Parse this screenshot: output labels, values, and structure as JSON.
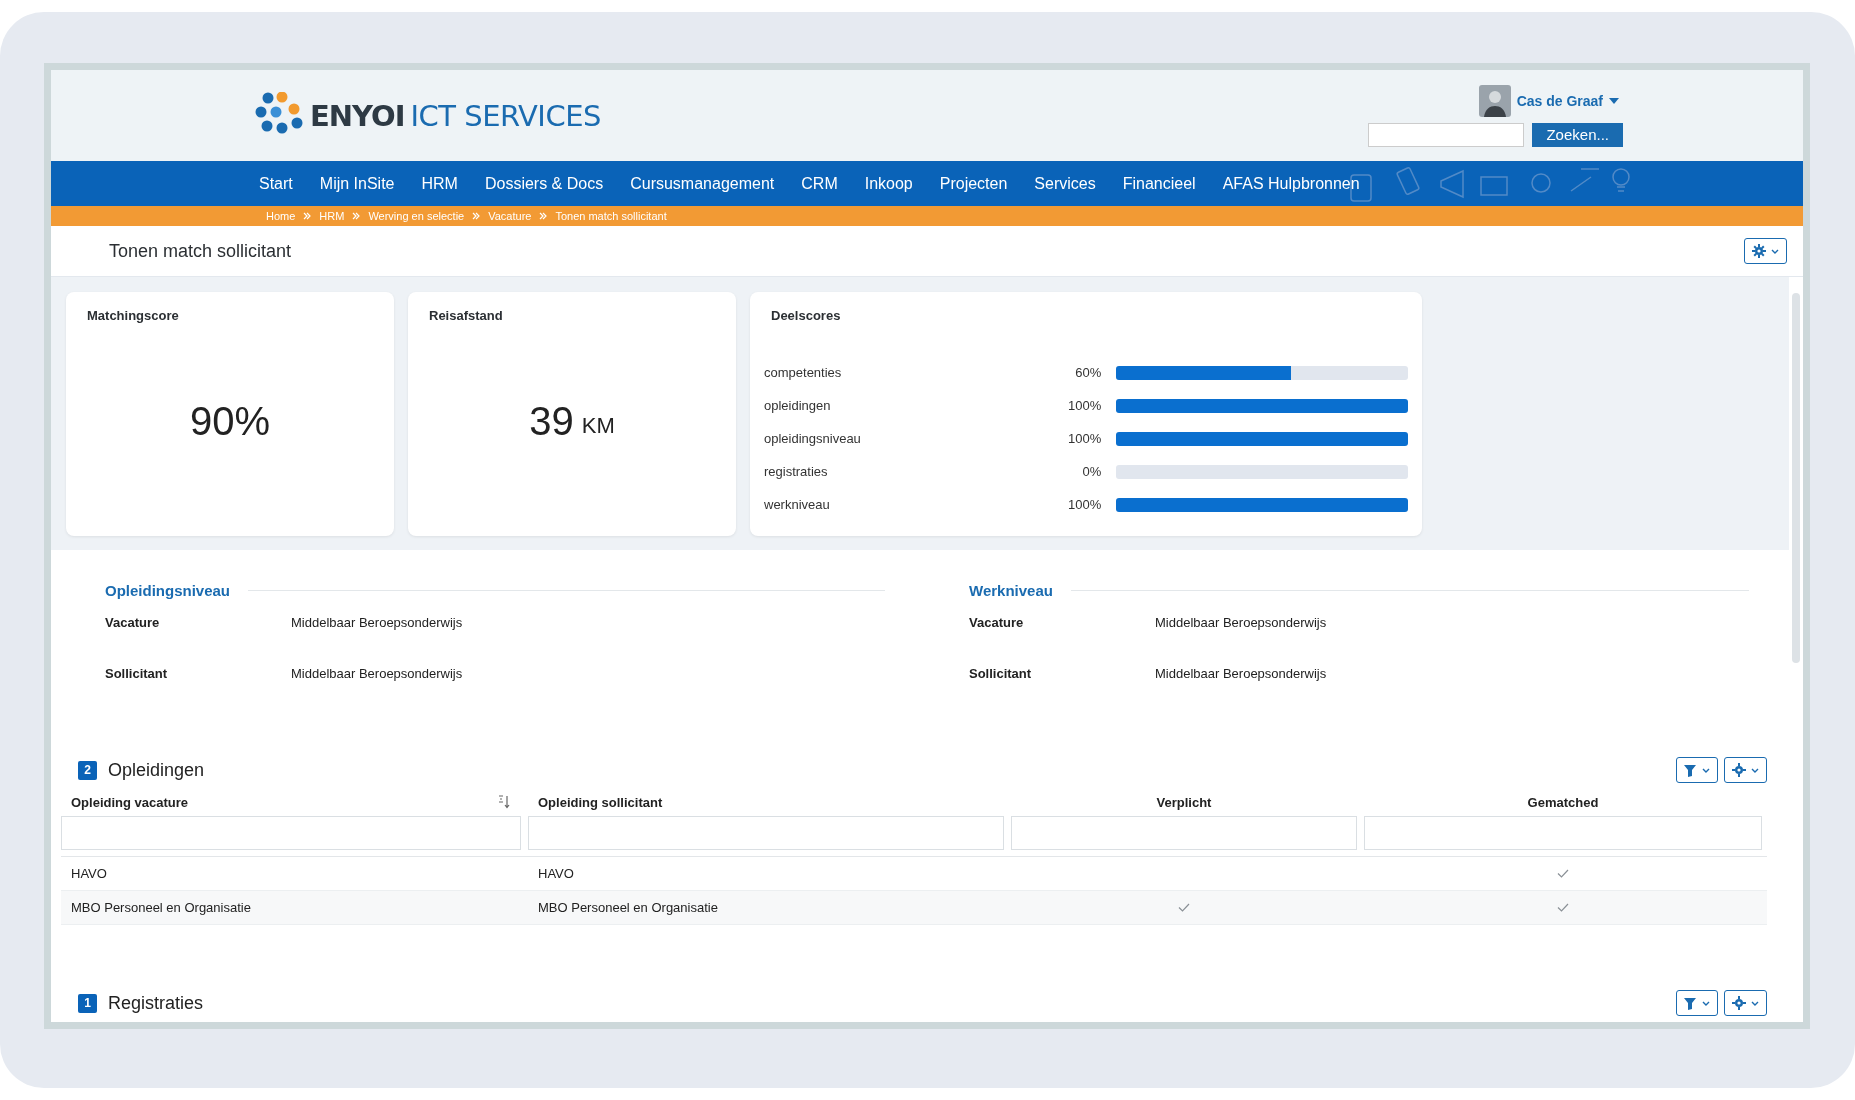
{
  "header": {
    "logo": {
      "brand": "ENYOI",
      "tagline": "ICT SERVICES"
    },
    "user": {
      "name": "Cas de Graaf"
    },
    "search": {
      "button": "Zoeken..."
    }
  },
  "nav": [
    {
      "label": "Start"
    },
    {
      "label": "Mijn InSite"
    },
    {
      "label": "HRM"
    },
    {
      "label": "Dossiers & Docs"
    },
    {
      "label": "Cursusmanagement"
    },
    {
      "label": "CRM"
    },
    {
      "label": "Inkoop"
    },
    {
      "label": "Projecten"
    },
    {
      "label": "Services"
    },
    {
      "label": "Financieel"
    },
    {
      "label": "AFAS Hulpbronnen"
    }
  ],
  "breadcrumb": [
    "Home",
    "HRM",
    "Werving en selectie",
    "Vacature",
    "Tonen match sollicitant"
  ],
  "page_title": "Tonen match sollicitant",
  "cards": [
    {
      "title": "Matchingscore",
      "value": "90%"
    },
    {
      "title": "Reisafstand",
      "value": "39",
      "unit": "KM"
    }
  ],
  "deelscores": {
    "title": "Deelscores",
    "rows": [
      {
        "label": "competenties",
        "reading": "60%",
        "level": 0.6
      },
      {
        "label": "opleidingen",
        "reading": "100%",
        "level": 1
      },
      {
        "label": "opleidingsniveau",
        "reading": "100%",
        "level": 1
      },
      {
        "label": "registraties",
        "reading": "0%",
        "level": 0
      },
      {
        "label": "werkniveau",
        "reading": "100%",
        "level": 1
      }
    ]
  },
  "details": [
    {
      "heading": "Opleidingsniveau",
      "rows": [
        {
          "label": "Vacature",
          "value": "Middelbaar Beroepsonderwijs"
        },
        {
          "label": "Sollicitant",
          "value": "Middelbaar Beroepsonderwijs"
        }
      ]
    },
    {
      "heading": "Werkniveau",
      "rows": [
        {
          "label": "Vacature",
          "value": "Middelbaar Beroepsonderwijs"
        },
        {
          "label": "Sollicitant",
          "value": "Middelbaar Beroepsonderwijs"
        }
      ]
    }
  ],
  "opleidingen": {
    "count": "2",
    "title": "Opleidingen",
    "columns": [
      "Opleiding vacature",
      "Opleiding sollicitant",
      "Verplicht",
      "Gematched"
    ],
    "rows": [
      {
        "vacature": "HAVO",
        "sollicitant": "HAVO",
        "verplicht": false,
        "gematched": true
      },
      {
        "vacature": "MBO Personeel en Organisatie",
        "sollicitant": "MBO Personeel en Organisatie",
        "verplicht": true,
        "gematched": true
      }
    ]
  },
  "registraties": {
    "count": "1",
    "title": "Registraties"
  }
}
